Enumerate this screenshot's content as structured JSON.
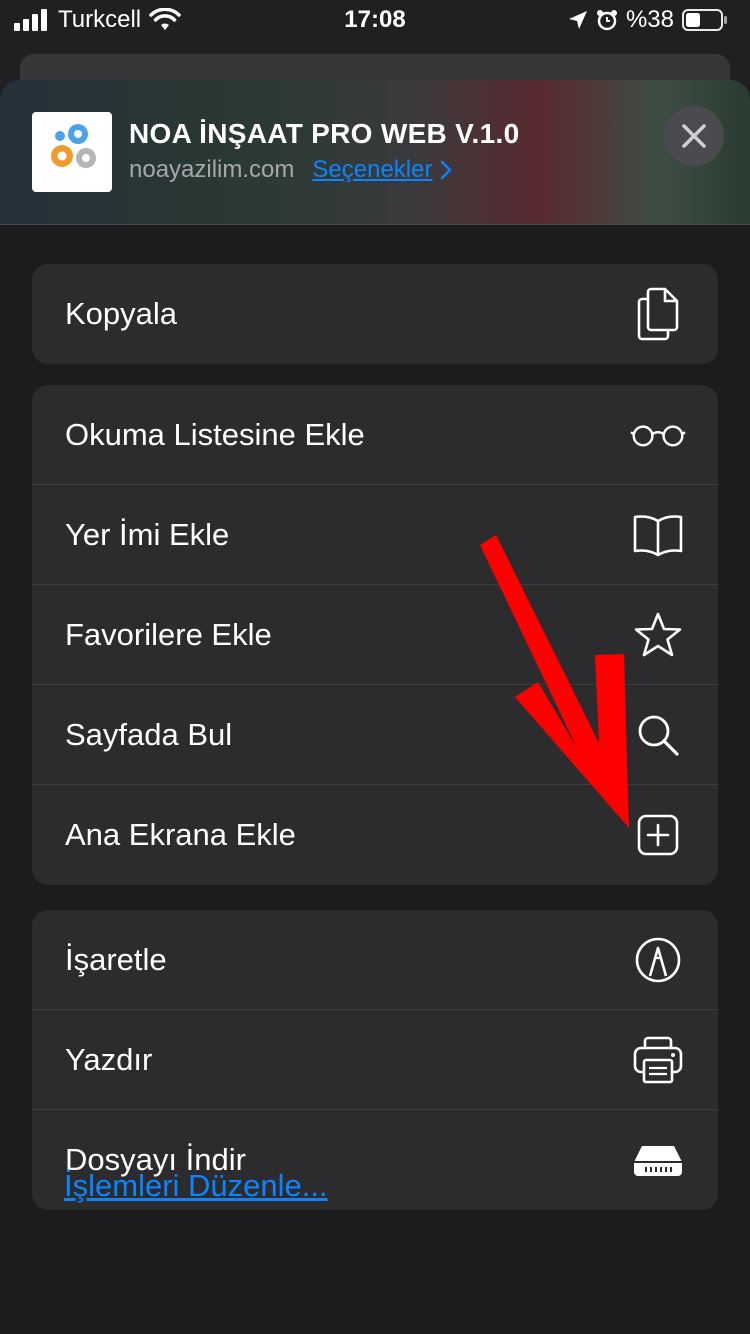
{
  "status": {
    "carrier": "Turkcell",
    "time": "17:08",
    "battery_text": "%38"
  },
  "header": {
    "site_title": "NOA İNŞAAT PRO WEB V.1.0",
    "site_domain": "noayazilim.com",
    "options_label": "Seçenekler"
  },
  "groups": {
    "g1": [
      {
        "label": "Kopyala",
        "icon": "copy-icon"
      }
    ],
    "g2": [
      {
        "label": "Okuma Listesine Ekle",
        "icon": "glasses-icon"
      },
      {
        "label": "Yer İmi Ekle",
        "icon": "book-icon"
      },
      {
        "label": "Favorilere Ekle",
        "icon": "star-icon"
      },
      {
        "label": "Sayfada Bul",
        "icon": "search-icon"
      },
      {
        "label": "Ana Ekrana Ekle",
        "icon": "add-square-icon"
      }
    ],
    "g3": [
      {
        "label": "İşaretle",
        "icon": "markup-icon"
      },
      {
        "label": "Yazdır",
        "icon": "printer-icon"
      },
      {
        "label": "Dosyayı İndir",
        "icon": "download-drive-icon"
      }
    ]
  },
  "footer": {
    "edit_actions_label": "İşlemleri Düzenle..."
  },
  "colors": {
    "accent": "#0a84ff",
    "annotation_arrow": "#ff0000"
  }
}
